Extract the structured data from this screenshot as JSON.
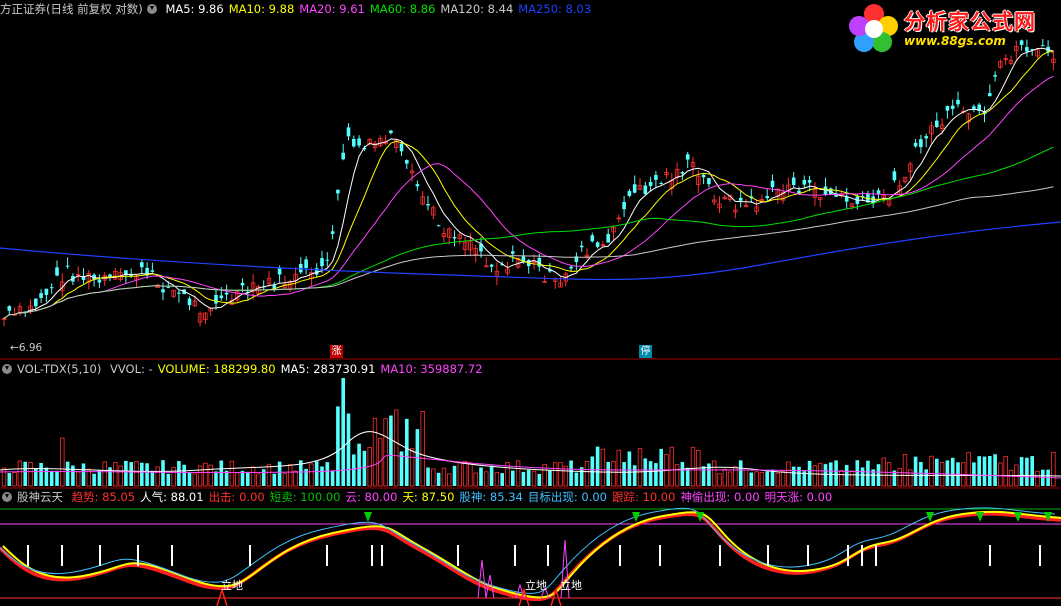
{
  "main_header": {
    "title": "方正证券(日线 前复权 对数)",
    "ma": [
      {
        "label": "MA5: 9.86",
        "color": "#ffffff"
      },
      {
        "label": "MA10: 9.88",
        "color": "#ffff00"
      },
      {
        "label": "MA20: 9.61",
        "color": "#ff44ff"
      },
      {
        "label": "MA60: 8.86",
        "color": "#00e000"
      },
      {
        "label": "MA120: 8.44",
        "color": "#c8c8c8"
      },
      {
        "label": "MA250: 8.03",
        "color": "#2040ff"
      }
    ]
  },
  "low_label": "6.96",
  "badges": [
    {
      "text": "涨",
      "color": "#c00000"
    },
    {
      "text": "停",
      "color": "#0088aa"
    }
  ],
  "vol_header": {
    "title": "VOL-TDX(5,10)",
    "items": [
      {
        "label": "VVOL: -",
        "color": "#c8c8c8"
      },
      {
        "label": "VOLUME: 188299.80",
        "color": "#ffff00"
      },
      {
        "label": "MA5: 283730.91",
        "color": "#ffffff"
      },
      {
        "label": "MA10: 359887.72",
        "color": "#ff44ff"
      }
    ]
  },
  "ind_header": {
    "title": "股神云天",
    "items": [
      {
        "label": "趋势: 85.05",
        "color": "#ff3030"
      },
      {
        "label": "人气: 88.01",
        "color": "#ffffff"
      },
      {
        "label": "出击: 0.00",
        "color": "#ff3030"
      },
      {
        "label": "短卖: 100.00",
        "color": "#00c000"
      },
      {
        "label": "云: 80.00",
        "color": "#ff44ff"
      },
      {
        "label": "天: 87.50",
        "color": "#ffff00"
      },
      {
        "label": "股神: 85.34",
        "color": "#40c0ff"
      },
      {
        "label": "目标出现: 0.00",
        "color": "#40c0ff"
      },
      {
        "label": "跟踪: 10.00",
        "color": "#ff3030"
      },
      {
        "label": "神偷出现: 0.00",
        "color": "#ff44ff"
      },
      {
        "label": "明天涨: 0.00",
        "color": "#ff44ff"
      }
    ]
  },
  "lidi_labels": [
    "立地",
    "立地",
    "立地"
  ],
  "logo": {
    "title": "分析家公式网",
    "url_text": "www.88gs.com"
  },
  "colors": {
    "up": "#ff3030",
    "down": "#54ffff",
    "ma5": "#ffffff",
    "ma10": "#ffff00",
    "ma20": "#ff44ff",
    "ma60": "#00e000",
    "ma120": "#c8c8c8",
    "ma250": "#2040ff",
    "divider": "#a00000"
  }
}
